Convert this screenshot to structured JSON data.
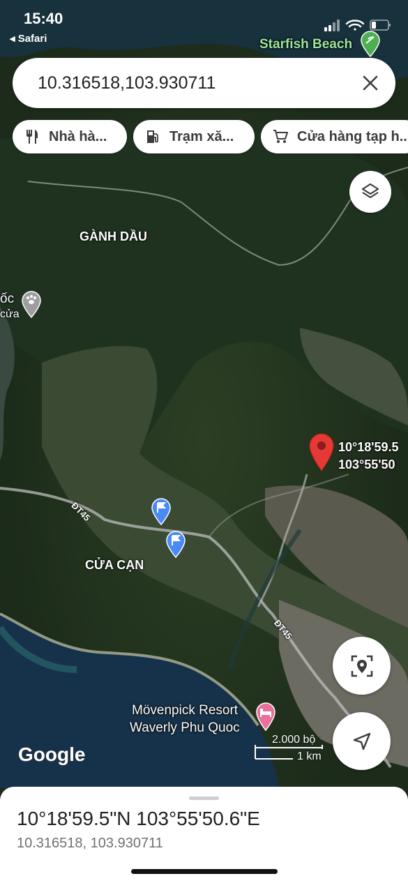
{
  "status_bar": {
    "time": "15:40",
    "back_app": "◂ Safari"
  },
  "search": {
    "query": "10.316518,103.930711"
  },
  "chips": [
    {
      "label": "Nhà hà...",
      "icon": "restaurant-icon"
    },
    {
      "label": "Trạm xă...",
      "icon": "gas-station-icon"
    },
    {
      "label": "Cửa hàng tạp h...",
      "icon": "grocery-cart-icon"
    }
  ],
  "map": {
    "labels": {
      "starfish": "Starfish Beach",
      "ganh_dau": "GÀNH DẦU",
      "cua_can": "CỬA CẠN",
      "road1": "ĐT45",
      "road2": "ĐT45",
      "left_poi_a": "ốc",
      "left_poi_b": "cửa",
      "resort_line1": "Mövenpick Resort",
      "resort_line2": "Waverly Phu Quoc"
    },
    "pin": {
      "lat_label": "10°18'59.5",
      "lng_label": "103°55'50"
    },
    "scale": {
      "imperial": "2.000 bộ",
      "metric": "1 km"
    },
    "attribution": "Google",
    "marker_color": "#e53935",
    "flag_color": "#4a8af4",
    "hotel_color": "#e8709a",
    "beach_color": "#4caf50"
  },
  "sheet": {
    "coords_dms": "10°18'59.5\"N 103°55'50.6\"E",
    "coords_decimal": "10.316518, 103.930711"
  }
}
